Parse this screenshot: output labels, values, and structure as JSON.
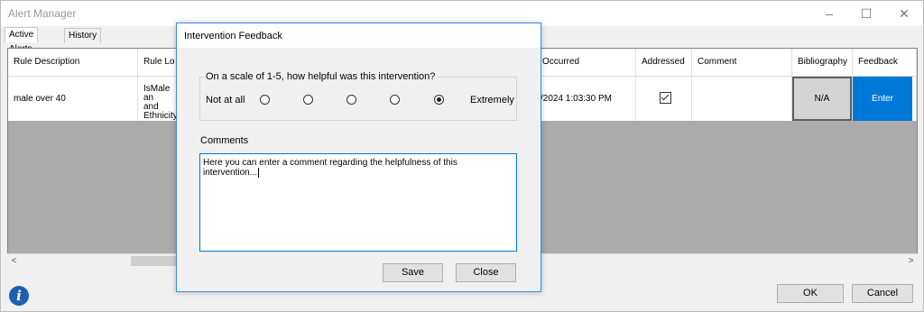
{
  "window": {
    "title": "Alert Manager",
    "controls": [
      "–",
      "☐",
      "✕"
    ]
  },
  "tabs": [
    {
      "label": "Active Alerts"
    },
    {
      "label": "History"
    }
  ],
  "grid": {
    "headers": [
      "Rule Description",
      "Rule Lo",
      "Occurred",
      "Addressed",
      "Comment",
      "Bibliography",
      "Feedback"
    ],
    "row": {
      "rule_description": "male over 40",
      "rule_logic": [
        "IsMale an",
        "and",
        "Ethnicity_"
      ],
      "occurred": "/2024 1:03:30 PM",
      "addressed": true,
      "comment": "",
      "bibliography": "N/A",
      "feedback": "Enter"
    }
  },
  "footer": {
    "ok": "OK",
    "cancel": "Cancel"
  },
  "dialog": {
    "title": "Intervention Feedback",
    "question": "On a scale of 1-5, how helpful was this intervention?",
    "low_label": "Not at all",
    "high_label": "Extremely",
    "selected_rating": 5,
    "comments_label": "Comments",
    "comments_value": "Here you can enter a comment regarding the helpfulness of this intervention...",
    "save": "Save",
    "close": "Close"
  },
  "colors": {
    "accent": "#0078d7",
    "info": "#1e5fb4"
  }
}
